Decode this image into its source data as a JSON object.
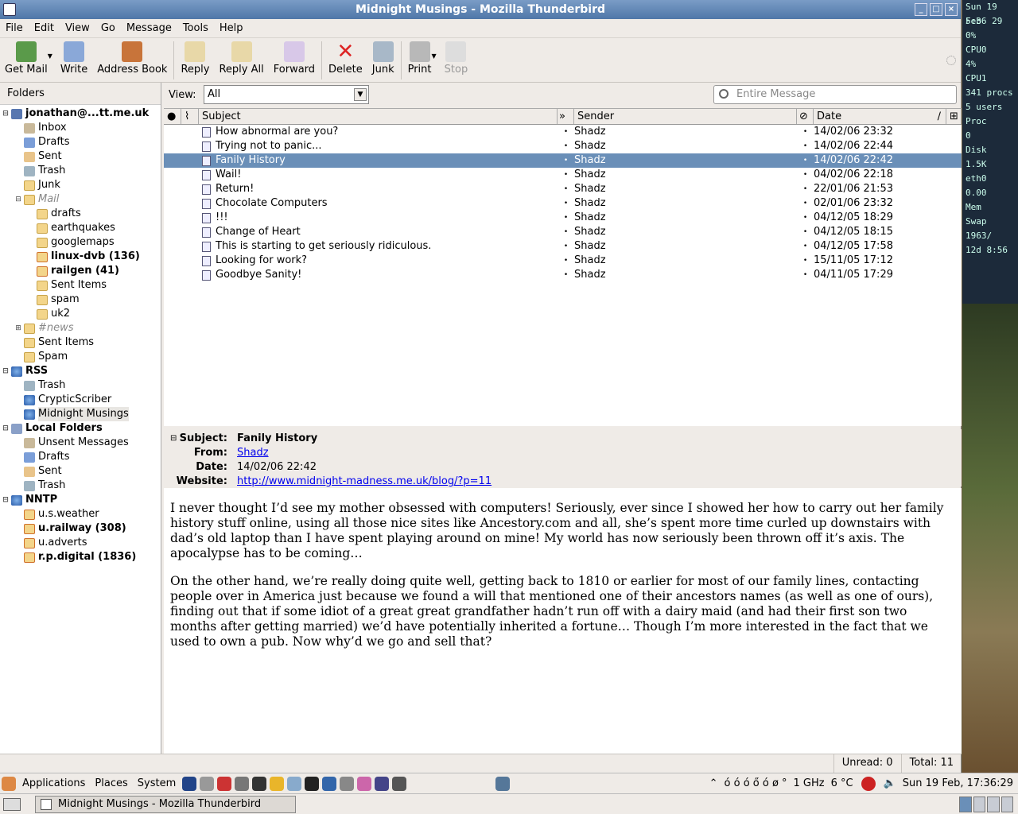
{
  "window": {
    "title": "Midnight Musings - Mozilla Thunderbird"
  },
  "menus": [
    "File",
    "Edit",
    "View",
    "Go",
    "Message",
    "Tools",
    "Help"
  ],
  "toolbar": {
    "get_mail": "Get Mail",
    "write": "Write",
    "address_book": "Address Book",
    "reply": "Reply",
    "reply_all": "Reply All",
    "forward": "Forward",
    "delete": "Delete",
    "junk": "Junk",
    "print": "Print",
    "stop": "Stop"
  },
  "folders": {
    "header": "Folders",
    "items": [
      {
        "label": "jonathan@...tt.me.uk",
        "level": 0,
        "kind": "acct",
        "twisty": "⊟",
        "bold": true
      },
      {
        "label": "Inbox",
        "level": 1,
        "kind": "in"
      },
      {
        "label": "Drafts",
        "level": 1,
        "kind": "dr"
      },
      {
        "label": "Sent",
        "level": 1,
        "kind": "se"
      },
      {
        "label": "Trash",
        "level": 1,
        "kind": "tr"
      },
      {
        "label": "Junk",
        "level": 1,
        "kind": "fo"
      },
      {
        "label": "Mail",
        "level": 1,
        "kind": "fo",
        "twisty": "⊟",
        "italic": true
      },
      {
        "label": "drafts",
        "level": 2,
        "kind": "fo"
      },
      {
        "label": "earthquakes",
        "level": 2,
        "kind": "fo"
      },
      {
        "label": "googlemaps",
        "level": 2,
        "kind": "fo"
      },
      {
        "label": "linux-dvb (136)",
        "level": 2,
        "kind": "nn",
        "bold": true
      },
      {
        "label": "railgen (41)",
        "level": 2,
        "kind": "nn",
        "bold": true
      },
      {
        "label": "Sent Items",
        "level": 2,
        "kind": "fo"
      },
      {
        "label": "spam",
        "level": 2,
        "kind": "fo"
      },
      {
        "label": "uk2",
        "level": 2,
        "kind": "fo"
      },
      {
        "label": "#news",
        "level": 1,
        "kind": "fo",
        "twisty": "⊞",
        "italic": true
      },
      {
        "label": "Sent Items",
        "level": 1,
        "kind": "fo"
      },
      {
        "label": "Spam",
        "level": 1,
        "kind": "fo"
      },
      {
        "label": "RSS",
        "level": 0,
        "kind": "rss",
        "twisty": "⊟",
        "bold": true
      },
      {
        "label": "Trash",
        "level": 1,
        "kind": "tr"
      },
      {
        "label": "CrypticScriber",
        "level": 1,
        "kind": "rss"
      },
      {
        "label": "Midnight Musings",
        "level": 1,
        "kind": "rss",
        "selected": true
      },
      {
        "label": "Local Folders",
        "level": 0,
        "kind": "loc",
        "twisty": "⊟",
        "bold": true
      },
      {
        "label": "Unsent Messages",
        "level": 1,
        "kind": "in"
      },
      {
        "label": "Drafts",
        "level": 1,
        "kind": "dr"
      },
      {
        "label": "Sent",
        "level": 1,
        "kind": "se"
      },
      {
        "label": "Trash",
        "level": 1,
        "kind": "tr"
      },
      {
        "label": "NNTP",
        "level": 0,
        "kind": "rss",
        "twisty": "⊟",
        "bold": true
      },
      {
        "label": "u.s.weather",
        "level": 1,
        "kind": "nn"
      },
      {
        "label": "u.railway (308)",
        "level": 1,
        "kind": "nn",
        "bold": true
      },
      {
        "label": "u.adverts",
        "level": 1,
        "kind": "nn"
      },
      {
        "label": "r.p.digital (1836)",
        "level": 1,
        "kind": "nn",
        "bold": true
      }
    ]
  },
  "view": {
    "label": "View:",
    "value": "All"
  },
  "search": {
    "placeholder": "Entire Message"
  },
  "columns": {
    "subject": "Subject",
    "sender": "Sender",
    "date": "Date"
  },
  "messages": [
    {
      "subject": "How abnormal are you?",
      "sender": "Shadz",
      "date": "14/02/06 23:32"
    },
    {
      "subject": "Trying not to panic...",
      "sender": "Shadz",
      "date": "14/02/06 22:44"
    },
    {
      "subject": "Fanily History",
      "sender": "Shadz",
      "date": "14/02/06 22:42",
      "selected": true
    },
    {
      "subject": "Wail!",
      "sender": "Shadz",
      "date": "04/02/06 22:18"
    },
    {
      "subject": "Return!",
      "sender": "Shadz",
      "date": "22/01/06 21:53"
    },
    {
      "subject": "Chocolate Computers",
      "sender": "Shadz",
      "date": "02/01/06 23:32"
    },
    {
      "subject": "!!!",
      "sender": "Shadz",
      "date": "04/12/05 18:29"
    },
    {
      "subject": "Change of Heart",
      "sender": "Shadz",
      "date": "04/12/05 18:15"
    },
    {
      "subject": "This is starting to get seriously ridiculous.",
      "sender": "Shadz",
      "date": "04/12/05 17:58"
    },
    {
      "subject": "Looking for work?",
      "sender": "Shadz",
      "date": "15/11/05 17:12"
    },
    {
      "subject": "Goodbye Sanity!",
      "sender": "Shadz",
      "date": "04/11/05 17:29"
    }
  ],
  "header": {
    "subject_k": "Subject:",
    "subject": "Fanily History",
    "from_k": "From:",
    "from": "Shadz",
    "date_k": "Date:",
    "date": "14/02/06 22:42",
    "website_k": "Website:",
    "website": "http://www.midnight-madness.me.uk/blog/?p=11"
  },
  "body": {
    "p1": "I never thought I’d see my mother obsessed with computers! Seriously, ever since I showed her how to carry out her family history stuff online, using all those nice sites like Ancestory.com and all, she’s spent more time curled up downstairs with dad’s old laptop than I have spent playing around on mine! My world has now seriously been thrown off it’s axis. The apocalypse has to be coming…",
    "p2": "On the other hand, we’re really doing quite well, getting back to 1810 or earlier for most of our family lines, contacting people over in America just because we found a will that mentioned one of their ancestors names (as well as one of ours), finding out that if some idiot of a great great grandfather hadn’t run off with a dairy maid (and had their first son two months after getting married) we’d have potentially inherited a fortune… Though I’m more interested in the fact that we used to own a pub. Now why’d we go and sell that?"
  },
  "status": {
    "unread": "Unread: 0",
    "total": "Total: 11"
  },
  "sidebar_monitor": [
    "Sun 19 Feb",
    "5:36 29",
    "0%",
    "CPU0",
    "4%",
    "CPU1",
    "341 procs",
    "5 users",
    "Proc",
    "0",
    "Disk",
    "1.5K",
    "eth0",
    "0.00",
    "Mem",
    "Swap",
    "1963/",
    "12d 8:56"
  ],
  "panel": {
    "applications": "Applications",
    "places": "Places",
    "system": "System",
    "cpu": "1 GHz",
    "temp": "6 °C",
    "clock": "Sun 19 Feb, 17:36:29"
  },
  "taskbar": {
    "window": "Midnight Musings - Mozilla Thunderbird"
  }
}
